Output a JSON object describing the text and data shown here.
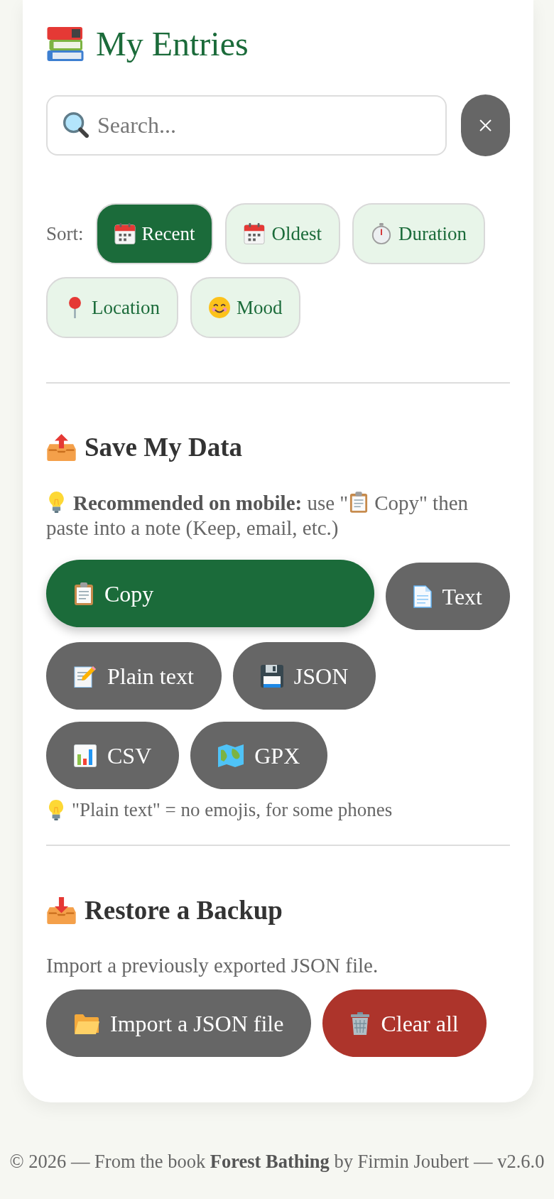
{
  "header": {
    "title": "My Entries"
  },
  "search": {
    "placeholder": "Search...",
    "clear_label": "×"
  },
  "sort": {
    "label": "Sort:",
    "options": [
      {
        "label": "Recent",
        "selected": true
      },
      {
        "label": "Oldest",
        "selected": false
      },
      {
        "label": "Duration",
        "selected": false
      },
      {
        "label": "Location",
        "selected": false
      },
      {
        "label": "Mood",
        "selected": false
      }
    ]
  },
  "save": {
    "heading": "Save My Data",
    "tip_parts": [
      "**Recommended on mobile:** use \"",
      "Copy\" then paste into a note (Keep, email, etc.)"
    ],
    "buttons": [
      {
        "label": "Copy",
        "kind": "primary"
      },
      {
        "label": "Text",
        "kind": "secondary"
      },
      {
        "label": "Plain text",
        "kind": "secondary"
      },
      {
        "label": "JSON",
        "kind": "secondary"
      },
      {
        "label": "CSV",
        "kind": "secondary"
      },
      {
        "label": "GPX",
        "kind": "secondary"
      }
    ],
    "note": "\"Plain text\" = no emojis, for some phones"
  },
  "restore": {
    "heading": "Restore a Backup",
    "description": "Import a previously exported JSON file.",
    "buttons": [
      {
        "label": "Import a JSON file",
        "kind": "secondary"
      },
      {
        "label": "Clear all",
        "kind": "danger"
      }
    ]
  },
  "footer": {
    "text": "© 2026 — From the book **Forest Bathing** by Firmin Joubert — v2.6.0"
  }
}
